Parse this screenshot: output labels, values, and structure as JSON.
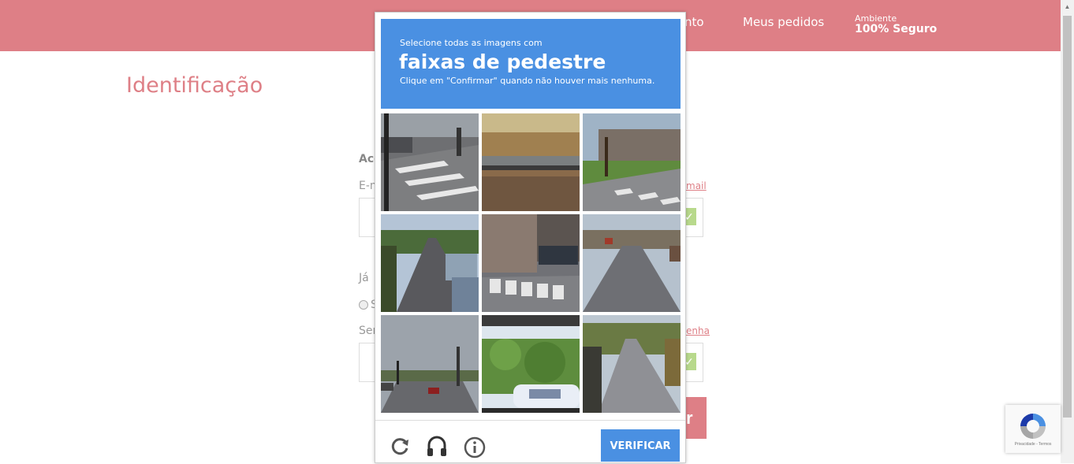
{
  "header": {
    "nav_partial": "nto",
    "nav_orders": "Meus pedidos",
    "env_small": "Ambiente",
    "env_big": "100% Seguro"
  },
  "page": {
    "title": "Identificação",
    "access_partial": "Acc",
    "email_partial": "E-m",
    "email_link_partial": "mail",
    "already_partial": "Já",
    "radio_label_partial": "S",
    "password_partial": "Sen",
    "password_link_partial": "enha",
    "button_partial": "r"
  },
  "captcha": {
    "instruction_top": "Selecione todas as imagens com",
    "target": "faixas de pedestre",
    "instruction_bottom": "Clique em \"Confirmar\" quando não houver mais nenhuma.",
    "verify_label": "VERIFICAR",
    "tiles": [
      "street-corner-crosswalk-pedestrian",
      "railroad-tracks",
      "park-lawn-crosswalk",
      "street-parked-cars",
      "building-street-crosswalk",
      "wide-road-cars",
      "intersection-traffic-lights",
      "foliage-car-window",
      "tree-lined-road"
    ],
    "icons": [
      "reload-icon",
      "headphones-icon",
      "info-icon"
    ]
  },
  "badge": {
    "text": "Privacidade - Termos"
  },
  "colors": {
    "brand": "#de7f86",
    "captcha_blue": "#4a90e2"
  }
}
